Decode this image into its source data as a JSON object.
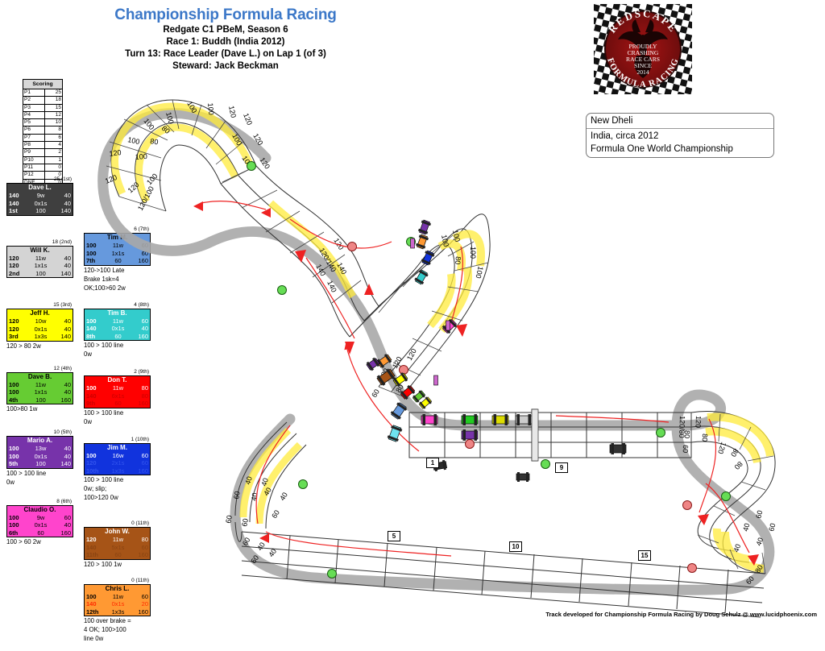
{
  "header": {
    "title": "Championship Formula Racing",
    "line1": "Redgate C1 PBeM, Season 6",
    "line2": "Race 1: Buddh (India 2012)",
    "line3": "Turn 13: Race Leader (Dave L.) on Lap 1 (of 3)",
    "line4": "Steward: Jack Beckman"
  },
  "scoring": {
    "caption": "Scoring",
    "rows": [
      {
        "pos": "P1",
        "pts": "25"
      },
      {
        "pos": "P2",
        "pts": "18"
      },
      {
        "pos": "P3",
        "pts": "15"
      },
      {
        "pos": "P4",
        "pts": "12"
      },
      {
        "pos": "P5",
        "pts": "10"
      },
      {
        "pos": "P6",
        "pts": "8"
      },
      {
        "pos": "P7",
        "pts": "6"
      },
      {
        "pos": "P8",
        "pts": "4"
      },
      {
        "pos": "P9",
        "pts": "2"
      },
      {
        "pos": "P10",
        "pts": "1"
      },
      {
        "pos": "P11",
        "pts": "0"
      },
      {
        "pos": "P12",
        "pts": "0"
      },
      {
        "pos": "DNF",
        "pts": "0"
      }
    ]
  },
  "logo": {
    "top_text": "REDSCAPE",
    "bottom_text": "FORMULA RACING",
    "center_lines": [
      "PROUDLY",
      "CRASHING",
      "RACE CARS",
      "SINCE",
      "2014"
    ]
  },
  "location": {
    "city": "New Dheli",
    "country_year": "India, circa 2012",
    "series": "Formula One World Championship"
  },
  "footer": {
    "credit": "Track developed for Championship Formula Racing by Doug Schulz @ www.lucidphoenix.com"
  },
  "drivers_left": [
    {
      "rank_points": "25 (1st)",
      "name": "Dave L.",
      "bg": "#3f3f3f",
      "fg": "#ffffff",
      "name_fg": "#ffffff",
      "r1": [
        "140",
        "9w",
        "40"
      ],
      "r2": [
        "140",
        "0x1s",
        "40"
      ],
      "r3": [
        "1st",
        "100",
        "140"
      ],
      "notes": []
    },
    {
      "rank_points": "18 (2nd)",
      "name": "Will K.",
      "bg": "#d4d4d4",
      "fg": "#000000",
      "name_fg": "#000000",
      "r1": [
        "120",
        "11w",
        "40"
      ],
      "r2": [
        "120",
        "1x1s",
        "40"
      ],
      "r3": [
        "2nd",
        "100",
        "140"
      ],
      "notes": []
    },
    {
      "rank_points": "15 (3rd)",
      "name": "Jeff H.",
      "bg": "#ffff00",
      "fg": "#000000",
      "name_fg": "#000000",
      "r1": [
        "120",
        "10w",
        "40"
      ],
      "r2": [
        "120",
        "0x1s",
        "40"
      ],
      "r3": [
        "3rd",
        "1x3s",
        "140"
      ],
      "notes": [
        "120 > 80 2w"
      ]
    },
    {
      "rank_points": "12 (4th)",
      "name": "Dave B.",
      "bg": "#66cc33",
      "fg": "#000000",
      "name_fg": "#000000",
      "r1": [
        "100",
        "11w",
        "40"
      ],
      "r2": [
        "100",
        "1x1s",
        "40"
      ],
      "r3": [
        "4th",
        "100",
        "160"
      ],
      "notes": [
        "100>80 1w"
      ]
    },
    {
      "rank_points": "10 (5th)",
      "name": "Mario A.",
      "bg": "#7733aa",
      "fg": "#ffffff",
      "name_fg": "#ffffff",
      "r1": [
        "100",
        "13w",
        "40"
      ],
      "r2": [
        "100",
        "0x1s",
        "40"
      ],
      "r3": [
        "5th",
        "100",
        "140"
      ],
      "notes": [
        "100 > 100 line",
        "0w"
      ]
    },
    {
      "rank_points": "8 (6th)",
      "name": "Claudio O.",
      "bg": "#ff44cc",
      "fg": "#000000",
      "name_fg": "#000000",
      "r1": [
        "100",
        "9w",
        "60"
      ],
      "r2": [
        "100",
        "0x1s",
        "40"
      ],
      "r3": [
        "6th",
        "60",
        "160"
      ],
      "notes": [
        "100 > 60 2w"
      ]
    }
  ],
  "drivers_mid": [
    {
      "rank_points": "6 (7th)",
      "name": "Tim M.",
      "bg": "#6699dd",
      "fg": "#000000",
      "name_fg": "#000000",
      "r1": [
        "100",
        "11w",
        "60"
      ],
      "r2": [
        "100",
        "1x1s",
        "60"
      ],
      "r3": [
        "7th",
        "60",
        "160"
      ],
      "notes": [
        "120->100 Late",
        "Brake 1sk=4",
        "OK;100>60 2w"
      ]
    },
    {
      "rank_points": "4 (8th)",
      "name": "Tim B.",
      "bg": "#33cccc",
      "fg": "#ffffff",
      "name_fg": "#ffffff",
      "r1": [
        "100",
        "11w",
        "60"
      ],
      "r2": [
        "140",
        "0x1s",
        "40"
      ],
      "r3": [
        "8th",
        "60",
        "160"
      ],
      "notes": [
        "100 > 100 line",
        "0w"
      ]
    },
    {
      "rank_points": "2 (9th)",
      "name": "Don T.",
      "bg": "#ff0000",
      "fg": "#cc0000",
      "name_fg": "#ffffff",
      "r1": [
        "100",
        "11w",
        "80"
      ],
      "r2": [
        "140",
        "6x1s",
        "80"
      ],
      "r3": [
        "9th",
        "60",
        "160"
      ],
      "notes": [
        "100 > 100 line",
        "0w"
      ]
    },
    {
      "rank_points": "1 (10th)",
      "name": "Jim M.",
      "bg": "#1133dd",
      "fg": "#3355ee",
      "name_fg": "#ffffff",
      "r1": [
        "100",
        "16w",
        "60"
      ],
      "r2": [
        "120",
        "2x1s",
        "60"
      ],
      "r3": [
        "10th",
        "1x3s",
        "160"
      ],
      "notes": [
        "100 > 100 line",
        "0w; slip;",
        "100>120 0w"
      ]
    },
    {
      "rank_points": "0 (11th)",
      "name": "John W.",
      "bg": "#a65417",
      "fg": "#8a4412",
      "name_fg": "#ffffff",
      "r1": [
        "120",
        "11w",
        "80"
      ],
      "r2": [
        "140",
        "5x1s",
        "60"
      ],
      "r3": [
        "11th",
        "60",
        "160"
      ],
      "notes": [
        "120 > 100 1w"
      ]
    },
    {
      "rank_points": "0 (11th)",
      "name": "Chris L.",
      "bg": "#ff9933",
      "fg": "#000000",
      "name_fg": "#000000",
      "r1": [
        "100",
        "11w",
        "60"
      ],
      "r2": [
        "140",
        "0x1s",
        "20"
      ],
      "r2_accent": "#ff2b00",
      "r3": [
        "12th",
        "1x3s",
        "160"
      ],
      "notes": [
        "100 over brake =",
        "4 OK; 100>100",
        "line 0w"
      ]
    }
  ],
  "track": {
    "corner_markers": [
      {
        "label": "5",
        "x": 481,
        "y": 659
      },
      {
        "label": "10",
        "x": 632,
        "y": 672
      },
      {
        "label": "15",
        "x": 792,
        "y": 683
      },
      {
        "label": "1",
        "x": 529,
        "y": 568
      },
      {
        "label": "9",
        "x": 689,
        "y": 574
      }
    ],
    "speed_labels_note": "Corner speed values printed along track edges: 40, 60, 80, 100, 120, 140",
    "start_finish": "pit straight with 6 cars staged at start/finish line"
  }
}
